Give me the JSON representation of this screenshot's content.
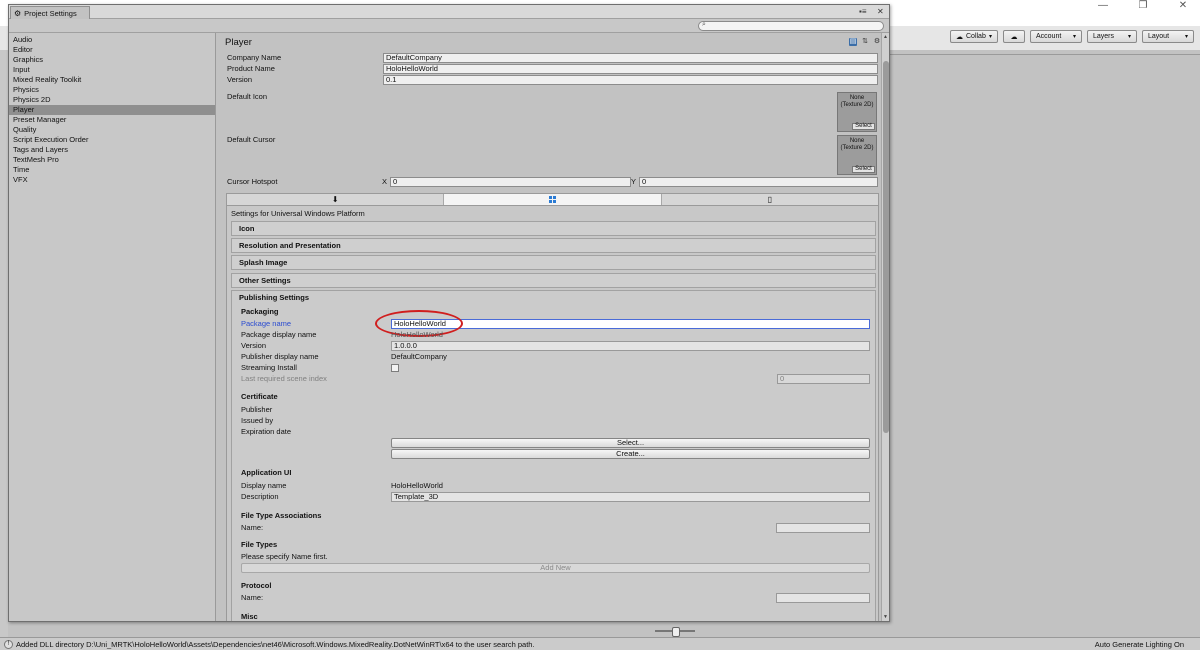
{
  "editor": {
    "toolbar": {
      "collab": "Collab",
      "account": "Account",
      "layers": "Layers",
      "layout": "Layout"
    },
    "status_message": "Added DLL directory D:\\Uni_MRTK\\HoloHelloWorld\\Assets\\Dependencies\\net46\\Microsoft.Windows.MixedReality.DotNetWinRT\\x64 to the user search path.",
    "status_right": "Auto Generate Lighting On"
  },
  "window": {
    "tab_title": "Project Settings"
  },
  "sidebar": {
    "items": [
      {
        "label": "Audio"
      },
      {
        "label": "Editor"
      },
      {
        "label": "Graphics"
      },
      {
        "label": "Input"
      },
      {
        "label": "Mixed Reality Toolkit"
      },
      {
        "label": "Physics"
      },
      {
        "label": "Physics 2D"
      },
      {
        "label": "Player",
        "selected": true
      },
      {
        "label": "Preset Manager"
      },
      {
        "label": "Quality"
      },
      {
        "label": "Script Execution Order"
      },
      {
        "label": "Tags and Layers"
      },
      {
        "label": "TextMesh Pro"
      },
      {
        "label": "Time"
      },
      {
        "label": "VFX"
      }
    ]
  },
  "player": {
    "title": "Player",
    "company_name_label": "Company Name",
    "company_name_value": "DefaultCompany",
    "product_name_label": "Product Name",
    "product_name_value": "HoloHelloWorld",
    "version_label": "Version",
    "version_value": "0.1",
    "default_icon_label": "Default Icon",
    "default_cursor_label": "Default Cursor",
    "texture_none": "None",
    "texture_type": "(Texture 2D)",
    "select_label": "Select",
    "cursor_hotspot_label": "Cursor Hotspot",
    "x_label": "X",
    "x_value": "0",
    "y_label": "Y",
    "y_value": "0"
  },
  "platform_tabs": [
    {
      "icon": "download-icon"
    },
    {
      "icon": "windows-icon",
      "active": true
    },
    {
      "icon": "phone-icon"
    }
  ],
  "settings": {
    "settings_for": "Settings for Universal Windows Platform",
    "sections": {
      "icon": "Icon",
      "resolution": "Resolution and Presentation",
      "splash": "Splash Image",
      "other": "Other Settings",
      "publishing": "Publishing Settings"
    }
  },
  "publishing": {
    "packaging_header": "Packaging",
    "package_name_label": "Package name",
    "package_name_value": "HoloHelloWorld",
    "package_display_name_label": "Package display name",
    "package_display_name_value": "HoloHelloWorld",
    "version_label": "Version",
    "version_value": "1.0.0.0",
    "publisher_display_name_label": "Publisher display name",
    "publisher_display_name_value": "DefaultCompany",
    "streaming_install_label": "Streaming Install",
    "last_scene_label": "Last required scene index",
    "last_scene_value": "0",
    "certificate_header": "Certificate",
    "publisher_label": "Publisher",
    "issued_by_label": "Issued by",
    "expiration_label": "Expiration date",
    "select_button": "Select...",
    "create_button": "Create...",
    "app_ui_header": "Application UI",
    "display_name_label": "Display name",
    "display_name_value": "HoloHelloWorld",
    "description_label": "Description",
    "description_value": "Template_3D",
    "file_type_assoc_header": "File Type Associations",
    "name_label": "Name:",
    "file_types_header": "File Types",
    "file_types_hint": "Please specify Name first.",
    "add_new_button": "Add New",
    "protocol_header": "Protocol",
    "protocol_name_label": "Name:",
    "misc_header": "Misc"
  },
  "colors": {
    "highlight_ellipse": "#d01e1e",
    "active_field_border": "#4a6bd8",
    "package_name_label": "#2a4bd0"
  }
}
